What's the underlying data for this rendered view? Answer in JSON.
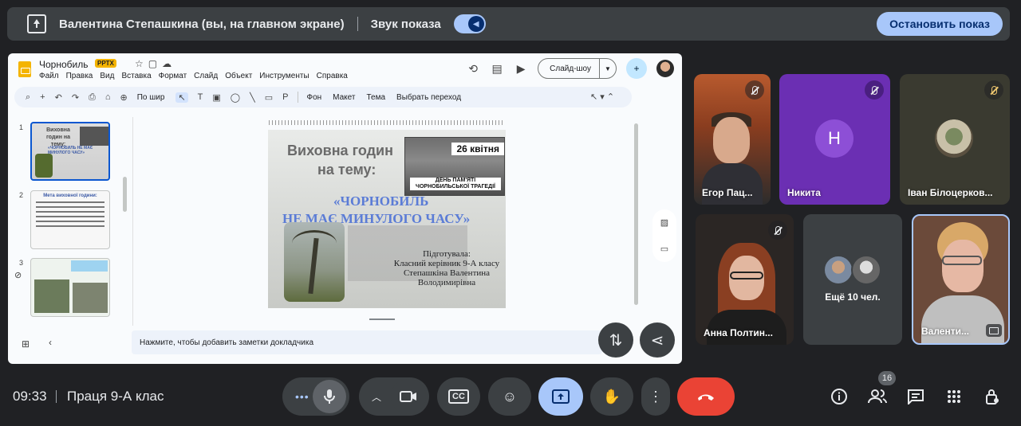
{
  "banner": {
    "presenter": "Валентина Степашкина (вы, на главном экране)",
    "sound_label": "Звук показа",
    "stop_label": "Остановить показ"
  },
  "slides_app": {
    "doc_title": "Чорнобиль",
    "format_badge": "PPTX",
    "menu": [
      "Файл",
      "Правка",
      "Вид",
      "Вставка",
      "Формат",
      "Слайд",
      "Объект",
      "Инструменты",
      "Справка"
    ],
    "slideshow_label": "Слайд-шоу",
    "toolbar": {
      "zoom": "По шир",
      "background": "Фон",
      "layout": "Макет",
      "theme": "Тема",
      "transition": "Выбрать переход"
    },
    "thumb_numbers": [
      "1",
      "2",
      "3"
    ],
    "thumbs": {
      "t1_title": "Виховна годин на тему:",
      "t1_sub": "«ЧОРНОБИЛЬ НЕ МАЄ МИНУЛОГО ЧАСУ»",
      "t2_title": "Мета виховної години:"
    },
    "slide": {
      "title_line1": "Виховна годин",
      "title_line2": "на тему:",
      "subtitle_line1": "«ЧОРНОБИЛЬ",
      "subtitle_line2": "НЕ МАЄ МИНУЛОГО ЧАСУ»",
      "photo_date": "26 квітня",
      "photo_caption": "ДЕНЬ ПАМ'ЯТІ ЧОРНОБИЛЬСЬКОЇ ТРАГЕДІЇ",
      "author_line1": "Підготувала:",
      "author_line2": "Класний керівник 9-А класу",
      "author_line3": "Степашкіна Валентина",
      "author_line4": "Володимирівна"
    },
    "notes_placeholder": "Нажмите, чтобы добавить заметки докладчика"
  },
  "participants": {
    "egor": "Егор Пац...",
    "nikita": "Никита",
    "nikita_initial": "H",
    "ivan": "Іван Білоцерков...",
    "anna": "Анна Полтин...",
    "more": "Ещё 10 чел.",
    "valentina": "Валенти..."
  },
  "bottom": {
    "time": "09:33",
    "meeting_name": "Праця 9-А клас",
    "cc_label": "CC",
    "participant_count": "16"
  },
  "colors": {
    "accent": "#a8c7fa",
    "end_call": "#ea4335",
    "nikita_tile": "#6b2fb3",
    "background": "#202124"
  }
}
